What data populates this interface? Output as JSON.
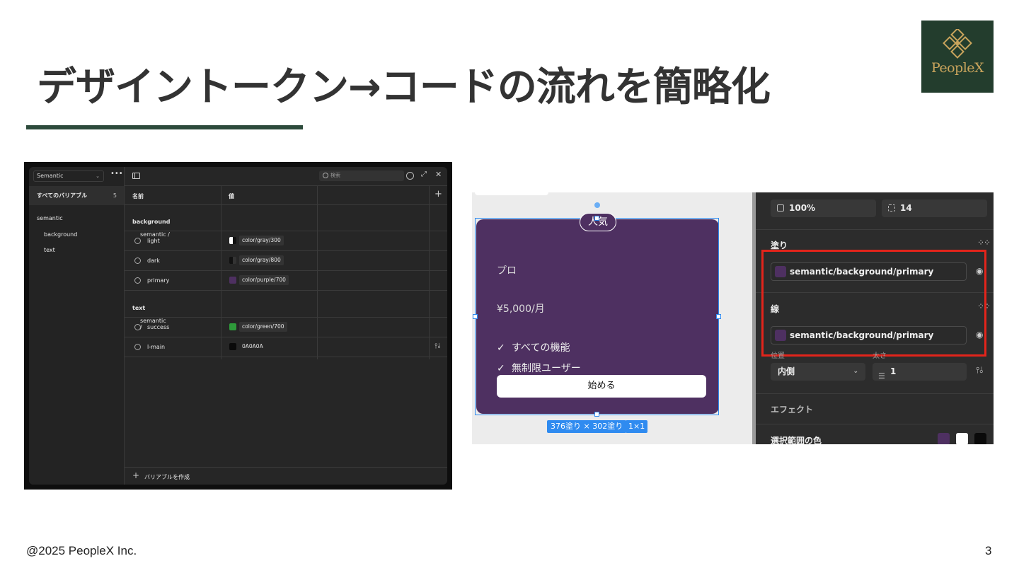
{
  "slide": {
    "title": "デザイントークン→コードの流れを簡略化",
    "footer": "@2025 PeopleX Inc.",
    "page_number": "3",
    "accent_color": "#2c4a3b"
  },
  "logo": {
    "text": "PeopleX",
    "icon": "diamond-logo-icon",
    "bg_color": "#233d2d",
    "fg_color": "#c9a45c"
  },
  "variables_panel": {
    "collection_select": "Semantic",
    "all_variables_label": "すべてのバリアブル",
    "all_variables_count": "5",
    "collection_name": "semantic",
    "groups_nav": [
      "background",
      "text"
    ],
    "search_placeholder": "検索",
    "col_name": "名前",
    "col_value": "値",
    "group_background": {
      "prefix": "semantic / ",
      "name": "background"
    },
    "group_text": {
      "prefix": "semantic / ",
      "name": "text"
    },
    "rows": [
      {
        "name": "light",
        "value": "color/gray/300",
        "swatch": "#e0e0e0"
      },
      {
        "name": "dark",
        "value": "color/gray/800",
        "swatch": "#1f1f1f"
      },
      {
        "name": "primary",
        "value": "color/purple/700",
        "swatch": "#4e3061"
      },
      {
        "name": "success",
        "value": "color/green/700",
        "swatch": "#2e9a3a"
      },
      {
        "name": "l-main",
        "value": "0A0A0A",
        "swatch": "#0a0a0a"
      }
    ],
    "create_label": "バリアブルを作成"
  },
  "design_tool": {
    "card": {
      "badge": "人気",
      "plan": "プロ",
      "price": "¥5,000/月",
      "features": [
        "すべての機能",
        "無制限ユーザー"
      ],
      "button": "始める",
      "bg_color": "#4e3061"
    },
    "size_label": "376塗り × 302塗り",
    "size_label2": "1×1",
    "panel": {
      "opacity": "100%",
      "radius": "14",
      "fill_label": "塗り",
      "fill_token": "semantic/background/primary",
      "stroke_label": "線",
      "stroke_token": "semantic/background/primary",
      "position_sub": "位置",
      "weight_sub": "太さ",
      "stroke_position": "内側",
      "stroke_weight": "1",
      "effect_label": "エフェクト",
      "selection_colors_label": "選択範囲の色",
      "selection_colors": [
        "#4e3061",
        "#ffffff",
        "#0a0a0a"
      ],
      "highlight_color": "#e3241b"
    }
  }
}
